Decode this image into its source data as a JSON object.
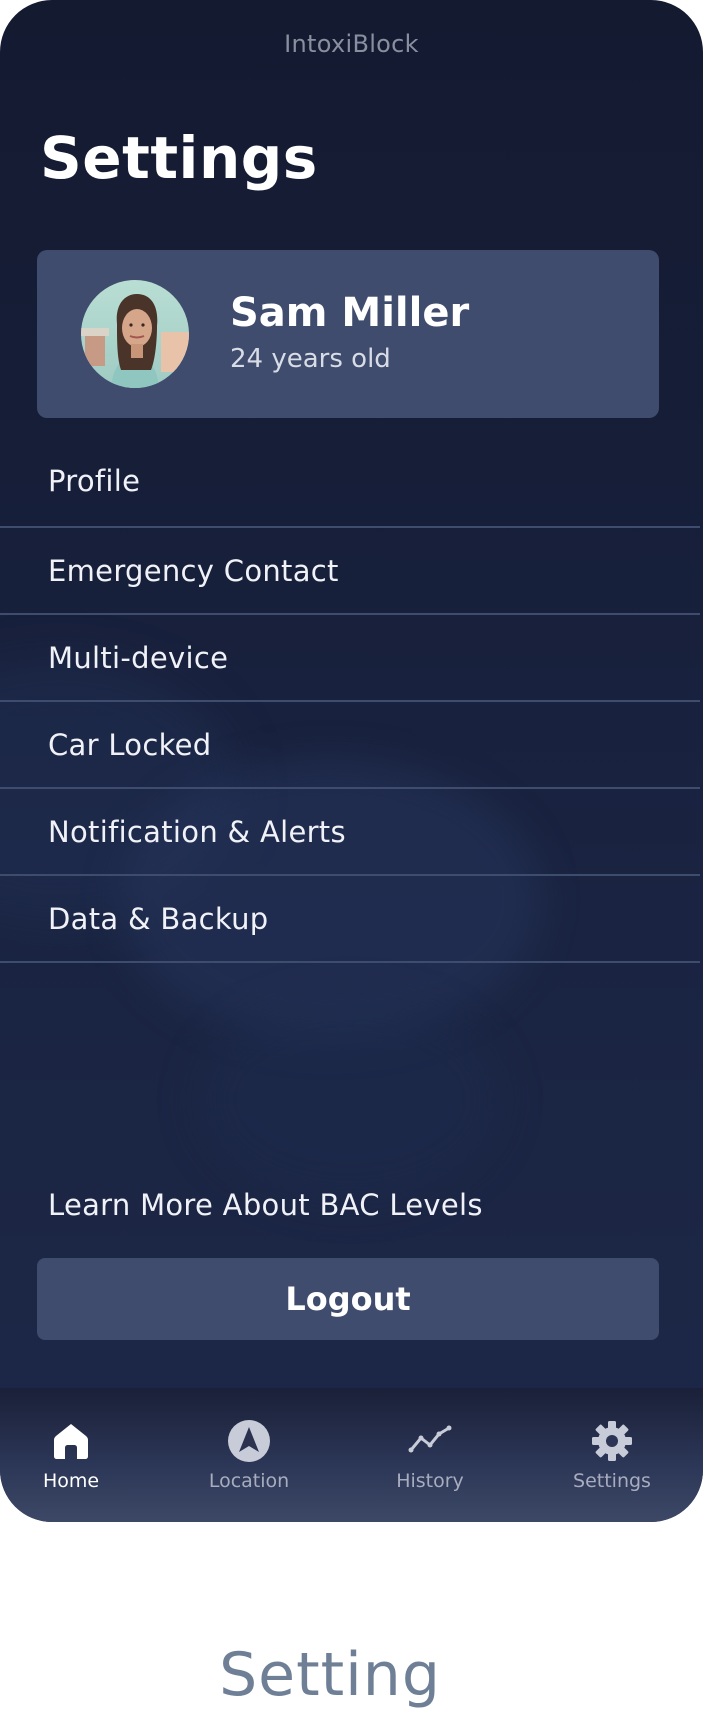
{
  "app": {
    "title": "IntoxiBlock"
  },
  "page": {
    "title": "Settings"
  },
  "profile": {
    "name": "Sam Miller",
    "age": "24 years old"
  },
  "menu": {
    "items": [
      {
        "label": "Profile"
      },
      {
        "label": "Emergency Contact"
      },
      {
        "label": "Multi-device"
      },
      {
        "label": "Car Locked"
      },
      {
        "label": "Notification & Alerts"
      },
      {
        "label": "Data & Backup"
      }
    ]
  },
  "links": {
    "learn_more": "Learn More About BAC Levels"
  },
  "actions": {
    "logout_label": "Logout"
  },
  "tab_bar": {
    "tabs": [
      {
        "label": "Home",
        "icon": "home-icon",
        "active": true
      },
      {
        "label": "Location",
        "icon": "navigation-arrow-icon",
        "active": false
      },
      {
        "label": "History",
        "icon": "trend-line-icon",
        "active": false
      },
      {
        "label": "Settings",
        "icon": "gear-icon",
        "active": false
      }
    ]
  },
  "caption": {
    "text": "Setting"
  },
  "colors": {
    "background": "#161e38",
    "card": "#3f4c6d",
    "divider": "#3e4c6e",
    "text_primary": "#ffffff",
    "text_muted": "#a7adbe"
  }
}
